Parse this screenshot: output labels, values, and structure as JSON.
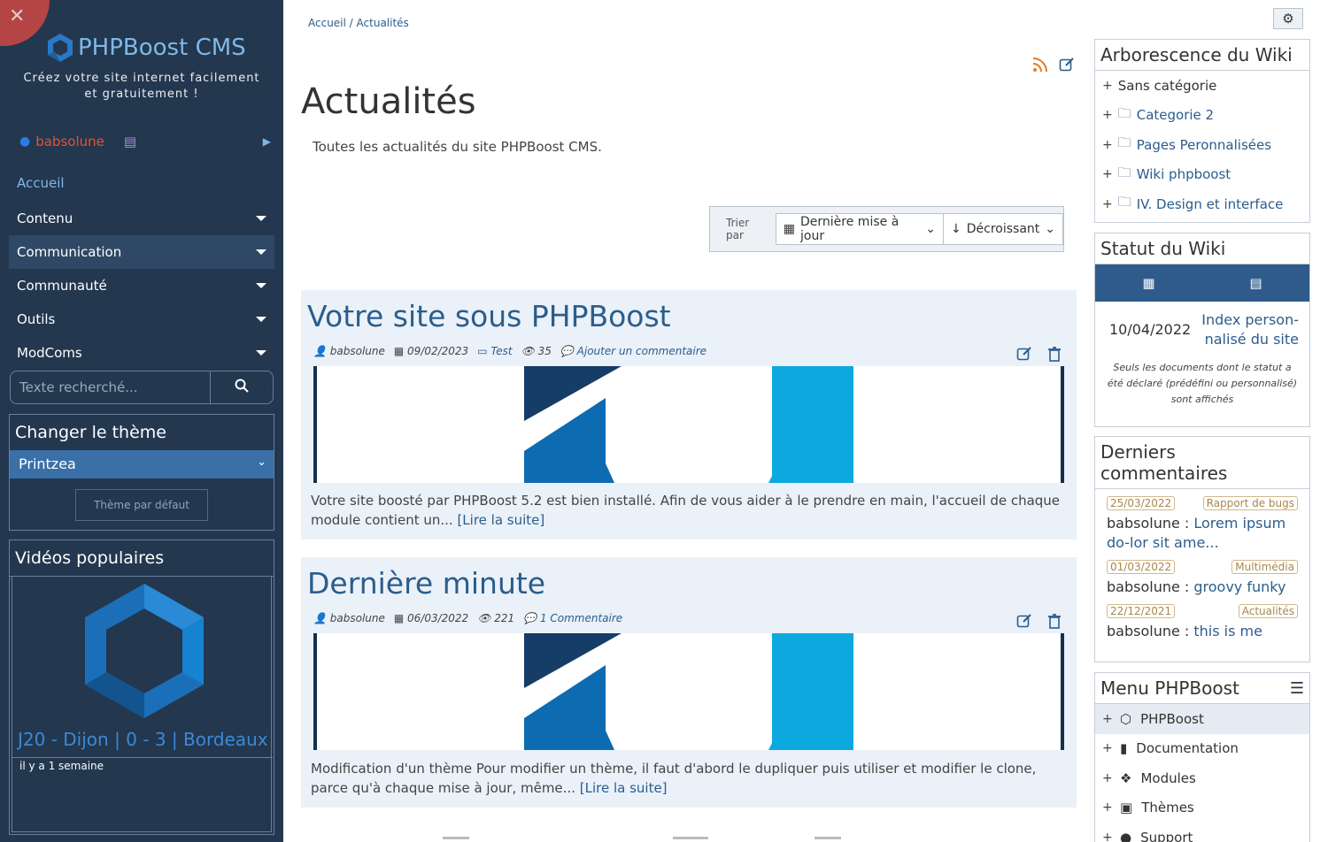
{
  "colors": {
    "sidebar_bg": "#23374f",
    "accent": "#2b5d8d",
    "user_name": "#e45232",
    "article_bg": "#eaf1f8",
    "status_bar": "#2e5b8c"
  },
  "close_icon": "close-icon",
  "site": {
    "name": "PHPBoost CMS",
    "slogan": "Créez votre site internet facilement et gratuitement !"
  },
  "user": {
    "name": "babsolune"
  },
  "nav": {
    "home": "Accueil",
    "items": [
      {
        "label": "Contenu"
      },
      {
        "label": "Communication"
      },
      {
        "label": "Communauté"
      },
      {
        "label": "Outils"
      },
      {
        "label": "ModComs"
      }
    ]
  },
  "search": {
    "placeholder": "Texte recherché..."
  },
  "theme_box": {
    "title": "Changer le thème",
    "selected": "Printzea",
    "default_button": "Thème par défaut"
  },
  "videos": {
    "title": "Vidéos populaires",
    "video_title": "J20 - Dijon | 0 - 3 | Bordeaux",
    "date": "il y a 1 semaine"
  },
  "breadcrumb": {
    "home": "Accueil",
    "separator": " / ",
    "current": "Actualités"
  },
  "page": {
    "title": "Actualités",
    "description": "Toutes les actualités du site PHPBoost CMS."
  },
  "sort": {
    "label": "Trier par",
    "field": "Dernière mise à jour",
    "order": "Décroissant"
  },
  "articles": [
    {
      "title": "Votre site sous PHPBoost",
      "author": "babsolune",
      "date": "09/02/2023",
      "category": "Test",
      "views": "35",
      "comments": "Ajouter un commentaire",
      "excerpt": "Votre site boosté par PHPBoost 5.2 est bien installé. Afin de vous aider à le prendre en main, l'accueil de chaque module contient un...",
      "read_more": "[Lire la suite]"
    },
    {
      "title": "Dernière minute",
      "author": "babsolune",
      "date": "06/03/2022",
      "views": "221",
      "comments": "1 Commentaire",
      "excerpt": "Modification d'un thème Pour modifier un thème, il faut d'abord le dupliquer puis utiliser et modifier le clone, parce qu'à chaque mise à jour, même...",
      "read_more": "[Lire la suite]"
    }
  ],
  "wiki_tree": {
    "title": "Arborescence du Wiki",
    "items": [
      {
        "label": "Sans catégorie"
      },
      {
        "label": "Categorie 2"
      },
      {
        "label": "Pages Peronnalisées"
      },
      {
        "label": "Wiki phpboost"
      },
      {
        "label": "IV. Design et interface"
      }
    ]
  },
  "wiki_status": {
    "title": "Statut du Wiki",
    "date": "10/04/2022",
    "index_line1": "Index person-",
    "index_line2": "nalisé du site",
    "note": "Seuls les documents dont le statut a été déclaré (prédéfini ou personnalisé) sont affichés"
  },
  "last_comments": {
    "title": "Derniers commentaires",
    "items": [
      {
        "date": "25/03/2022",
        "module": "Rapport de bugs",
        "author": "babsolune",
        "sep": " : ",
        "message": "Lorem ipsum do-lor sit ame..."
      },
      {
        "date": "01/03/2022",
        "module": "Multimédia",
        "author": "babsolune",
        "sep": " : ",
        "message": "groovy funky"
      },
      {
        "date": "22/12/2021",
        "module": "Actualités",
        "author": "babsolune",
        "sep": " : ",
        "message": "this is me"
      }
    ]
  },
  "menu_phpboost": {
    "title": "Menu PHPBoost",
    "items": [
      {
        "label": "PHPBoost",
        "icon": "phpboost-icon"
      },
      {
        "label": "Documentation",
        "icon": "book-icon"
      },
      {
        "label": "Modules",
        "icon": "cubes-icon"
      },
      {
        "label": "Thèmes",
        "icon": "image-icon"
      },
      {
        "label": "Support",
        "icon": "info-icon"
      }
    ]
  }
}
